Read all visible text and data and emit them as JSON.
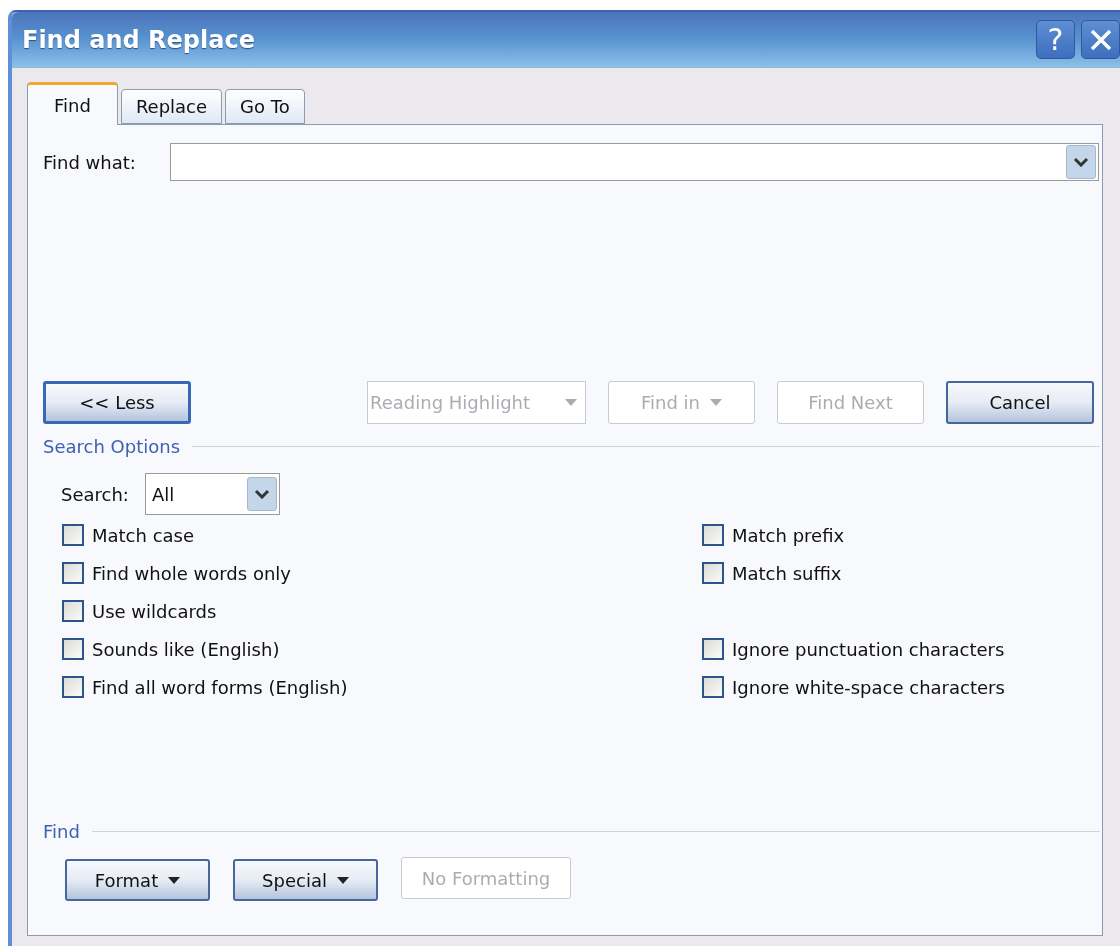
{
  "window": {
    "title": "Find and Replace",
    "controls": [
      {
        "kind": "help",
        "label": "?"
      },
      {
        "kind": "close"
      }
    ]
  },
  "tabs": [
    {
      "label": "Find",
      "selected": true
    },
    {
      "label": "Replace",
      "selected": false
    },
    {
      "label": "Go To",
      "selected": false
    }
  ],
  "find_what": {
    "label": "Find what:"
  },
  "actions": [
    {
      "kind": "button",
      "label": "<< Less",
      "disabled": false,
      "default": true
    },
    {
      "kind": "dropdown",
      "label": "Reading Highlight",
      "disabled": true,
      "default": false
    },
    {
      "kind": "menu",
      "label": "Find in",
      "disabled": true,
      "default": false
    },
    {
      "kind": "button",
      "label": "Find Next",
      "disabled": true,
      "default": false
    },
    {
      "kind": "button",
      "label": "Cancel",
      "disabled": false,
      "default": false
    }
  ],
  "search_options": {
    "heading": "Search Options",
    "search_label": "Search:",
    "search_value": "All",
    "left": [
      {
        "label": "Match case",
        "checked": false
      },
      {
        "label": "Find whole words only",
        "checked": false
      },
      {
        "label": "Use wildcards",
        "checked": false
      },
      {
        "label": "Sounds like (English)",
        "checked": false
      },
      {
        "label": "Find all word forms (English)",
        "checked": false
      }
    ],
    "right_groups": [
      [
        {
          "label": "Match prefix",
          "checked": false
        },
        {
          "label": "Match suffix",
          "checked": false
        }
      ],
      [
        {
          "label": "Ignore punctuation characters",
          "checked": false
        },
        {
          "label": "Ignore white-space characters",
          "checked": false
        }
      ]
    ]
  },
  "find_section": {
    "heading": "Find",
    "buttons": [
      {
        "kind": "menu",
        "label": "Format",
        "disabled": false
      },
      {
        "kind": "menu",
        "label": "Special",
        "disabled": false
      },
      {
        "kind": "button",
        "label": "No Formatting",
        "disabled": true
      }
    ]
  }
}
